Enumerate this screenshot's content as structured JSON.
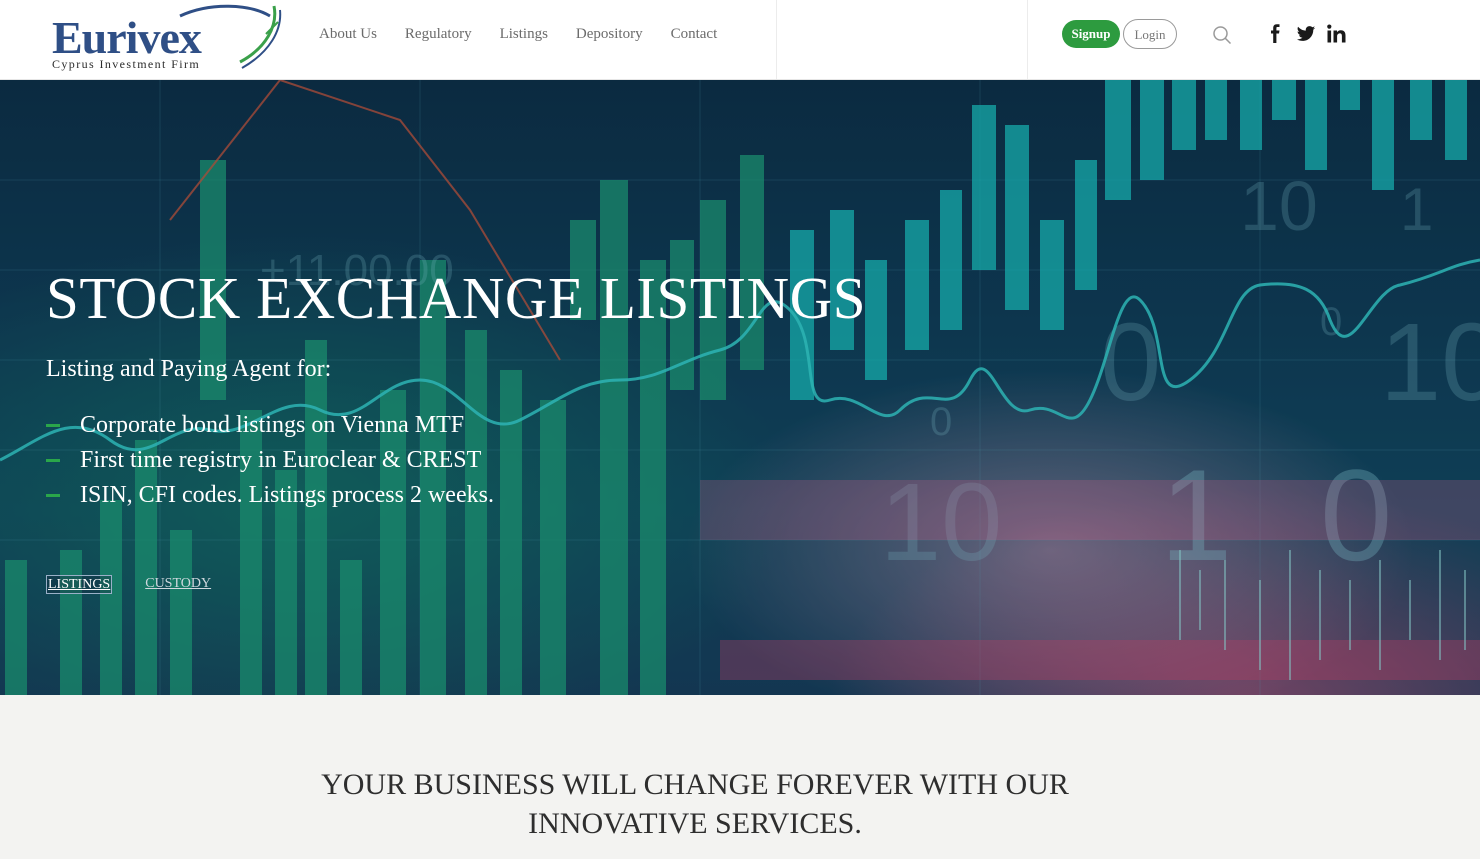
{
  "logo": {
    "name": "Eurivex",
    "tagline": "Cyprus Investment Firm"
  },
  "nav": {
    "items": [
      {
        "label": "About Us"
      },
      {
        "label": "Regulatory"
      },
      {
        "label": "Listings"
      },
      {
        "label": "Depository"
      },
      {
        "label": "Contact"
      }
    ]
  },
  "auth": {
    "signup_label": "Signup",
    "login_label": "Login"
  },
  "icons": {
    "search": "search-icon",
    "social": [
      "facebook-icon",
      "twitter-icon",
      "linkedin-icon"
    ]
  },
  "hero": {
    "title": "STOCK EXCHANGE LISTINGS",
    "subtitle": "Listing and Paying Agent for:",
    "bullets": [
      {
        "text": "Corporate bond listings on Vienna MTF"
      },
      {
        "text": "First time registry in Euroclear & CREST"
      },
      {
        "text": "ISIN, CFI codes. Listings process 2 weeks."
      }
    ],
    "tabs": [
      {
        "label": "LISTINGS",
        "active": true
      },
      {
        "label": "CUSTODY",
        "active": false
      }
    ]
  },
  "section": {
    "heading_line1": "YOUR BUSINESS WILL CHANGE FOREVER WITH OUR",
    "heading_line2": "INNOVATIVE SERVICES."
  },
  "colors": {
    "brand_blue": "#2f4f86",
    "signup_green": "#2d9b3f",
    "bullet_green": "#2aa64a",
    "hero_dark": "#0f3b55",
    "section_bg": "#f3f3f1"
  }
}
